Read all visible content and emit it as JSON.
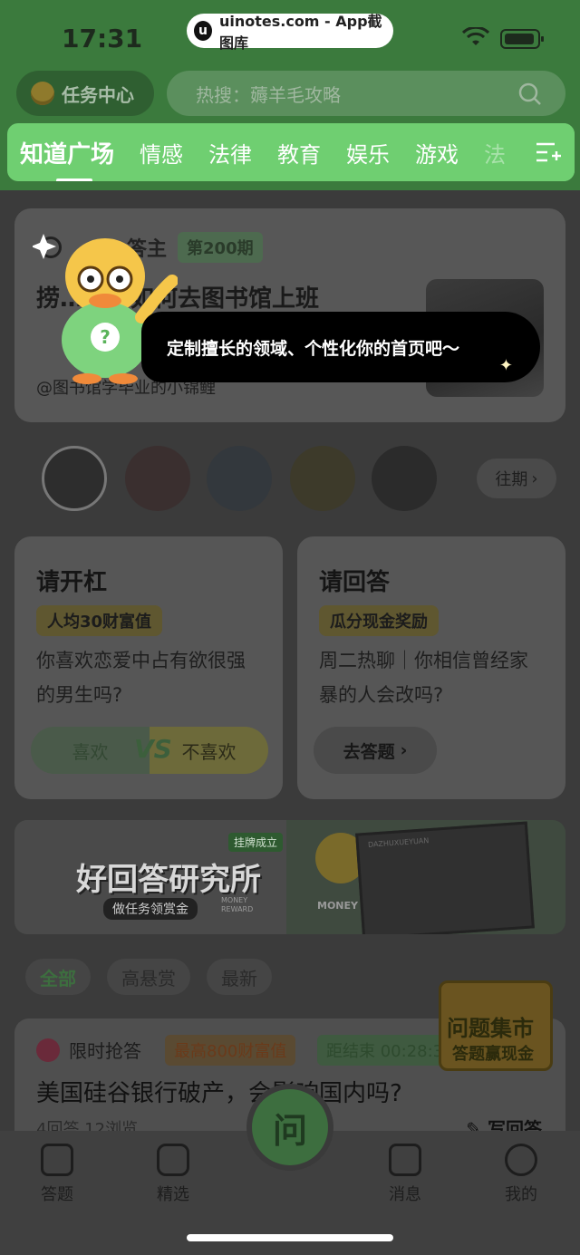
{
  "status_bar": {
    "time": "17:31",
    "watermark": "uinotes.com - App截图库",
    "watermark_icon": "u"
  },
  "header": {
    "task_center": "任务中心",
    "search_placeholder": "热搜：薅羊毛攻略"
  },
  "tabs": [
    "知道广场",
    "情感",
    "法律",
    "教育",
    "娱乐",
    "游戏",
    "法"
  ],
  "featured": {
    "head": "答主",
    "issue": "第200期",
    "title": "捞…耕，如何去图书馆上班",
    "author": "@图书馆学毕业的小锦鲤"
  },
  "tooltip": {
    "text": "定制擅长的领域、个性化你的首页吧～"
  },
  "mascot": {
    "badge_glyph": "?"
  },
  "avatars_more": "往期",
  "cards": {
    "debate": {
      "title": "请开杠",
      "badge": "人均30财富值",
      "question": "你喜欢恋爱中占有欲很强的男生吗?",
      "yes": "喜欢",
      "vs": "VS",
      "no": "不喜欢"
    },
    "answer": {
      "title": "请回答",
      "badge": "瓜分现金奖励",
      "question": "周二热聊｜你相信曾经家暴的人会改吗?",
      "button": "去答题"
    }
  },
  "banner": {
    "tag": "挂牌成立",
    "title": "好回答研究所",
    "subtitle": "做任务领赏金",
    "money_left": "MONEY REWARD",
    "money_right": "MONEY",
    "lab": "DAZHUXUEYUAN"
  },
  "filters": [
    "全部",
    "高悬赏",
    "最新"
  ],
  "market": {
    "line1": "问题集市",
    "line2": "答题赢现金"
  },
  "question": {
    "flash": "限时抢答",
    "reward": "最高800财富值",
    "countdown": "距结束 00:28:3",
    "title": "美国硅谷银行破产，会影响国内吗?",
    "meta": "4回答  12浏览",
    "write": "写回答"
  },
  "nav": {
    "items": [
      "答题",
      "精选",
      "消息",
      "我的"
    ],
    "ask": "问"
  },
  "colors": {
    "brand_green": "#6fcf71",
    "header_green": "#3b7a3d",
    "tooltip_bg": "#000000"
  }
}
